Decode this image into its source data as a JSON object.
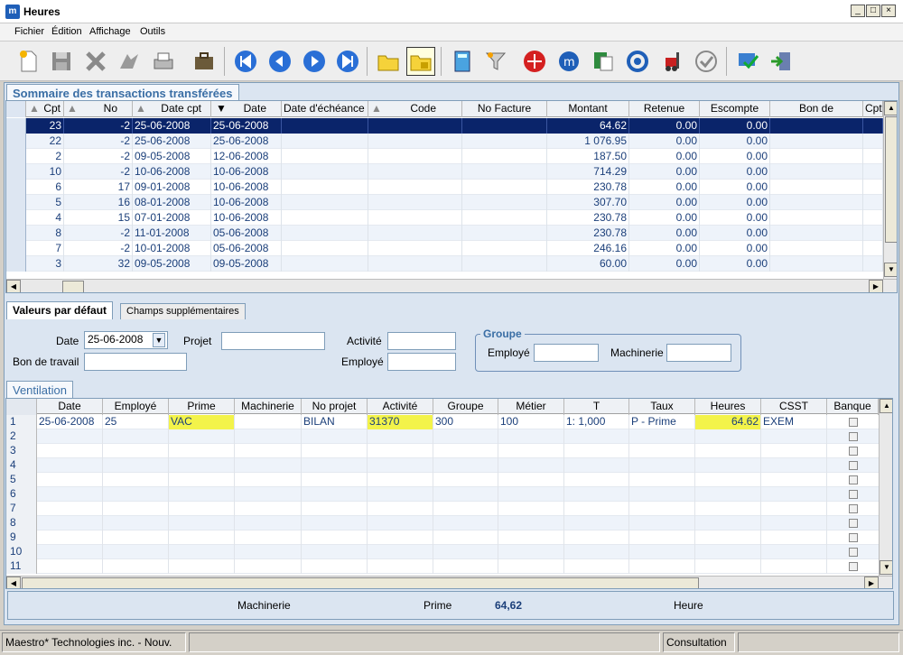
{
  "window": {
    "title": "Heures",
    "app_icon_letter": "m"
  },
  "menu": [
    "Fichier",
    "Édition",
    "Affichage",
    "Outils"
  ],
  "toolbar": {
    "icons": [
      "new-document-icon",
      "save-icon",
      "delete-icon",
      "transfer-icon",
      "print-icon",
      "briefcase-icon",
      "first-record-icon",
      "previous-record-icon",
      "next-record-icon",
      "last-record-icon",
      "folder-icon",
      "locked-folder-icon",
      "calculator-icon",
      "filter-icon",
      "target-icon",
      "maestro-link-icon",
      "excel-export-icon",
      "sync-icon",
      "forklift-icon",
      "approve-icon",
      "validate-icon",
      "exit-icon"
    ]
  },
  "summary": {
    "tab": "Sommaire des transactions transférées",
    "columns": [
      "Cpt",
      "No",
      "Date cpt",
      "Date",
      "Date d'échéance",
      "Code",
      "No Facture",
      "Montant",
      "Retenue",
      "Escompte",
      "Bon de",
      "Cpte"
    ],
    "rows": [
      [
        "23",
        "-2",
        "25-06-2008",
        "25-06-2008",
        "",
        "",
        "",
        "64.62",
        "0.00",
        "0.00",
        "",
        ""
      ],
      [
        "22",
        "-2",
        "25-06-2008",
        "25-06-2008",
        "",
        "",
        "",
        "1 076.95",
        "0.00",
        "0.00",
        "",
        ""
      ],
      [
        "2",
        "-2",
        "09-05-2008",
        "12-06-2008",
        "",
        "",
        "",
        "187.50",
        "0.00",
        "0.00",
        "",
        ""
      ],
      [
        "10",
        "-2",
        "10-06-2008",
        "10-06-2008",
        "",
        "",
        "",
        "714.29",
        "0.00",
        "0.00",
        "",
        ""
      ],
      [
        "6",
        "17",
        "09-01-2008",
        "10-06-2008",
        "",
        "",
        "",
        "230.78",
        "0.00",
        "0.00",
        "",
        ""
      ],
      [
        "5",
        "16",
        "08-01-2008",
        "10-06-2008",
        "",
        "",
        "",
        "307.70",
        "0.00",
        "0.00",
        "",
        ""
      ],
      [
        "4",
        "15",
        "07-01-2008",
        "10-06-2008",
        "",
        "",
        "",
        "230.78",
        "0.00",
        "0.00",
        "",
        ""
      ],
      [
        "8",
        "-2",
        "11-01-2008",
        "05-06-2008",
        "",
        "",
        "",
        "230.78",
        "0.00",
        "0.00",
        "",
        ""
      ],
      [
        "7",
        "-2",
        "10-01-2008",
        "05-06-2008",
        "",
        "",
        "",
        "246.16",
        "0.00",
        "0.00",
        "",
        ""
      ],
      [
        "3",
        "32",
        "09-05-2008",
        "09-05-2008",
        "",
        "",
        "",
        "60.00",
        "0.00",
        "0.00",
        "",
        ""
      ]
    ]
  },
  "defaults": {
    "tab_active": "Valeurs par défaut",
    "tab_other": "Champs supplémentaires",
    "date_label": "Date",
    "date_value": "25-06-2008",
    "projet_label": "Projet",
    "activite_label": "Activité",
    "bon_label": "Bon de travail",
    "employe_label": "Employé",
    "groupe_title": "Groupe",
    "groupe_employe_label": "Employé",
    "groupe_machinerie_label": "Machinerie"
  },
  "ventilation": {
    "tab": "Ventilation",
    "columns": [
      "Date",
      "Employé",
      "Prime",
      "Machinerie",
      "No projet",
      "Activité",
      "Groupe",
      "Métier",
      "T",
      "Taux",
      "Heures",
      "CSST",
      "Banque"
    ],
    "row_numbers": [
      "1",
      "2",
      "3",
      "4",
      "5",
      "6",
      "7",
      "8",
      "9",
      "10",
      "11"
    ],
    "rows": [
      [
        "25-06-2008",
        "25",
        "VAC",
        "",
        "BILAN",
        "31370",
        "300",
        "100",
        "1: 1,000",
        "P -  Prime",
        "64.62",
        "EXEM",
        ""
      ]
    ]
  },
  "totals": {
    "machinerie_label": "Machinerie",
    "prime_label": "Prime",
    "prime_value": "64,62",
    "heure_label": "Heure"
  },
  "status": {
    "company": "Maestro* Technologies inc. - Nouv.",
    "mode": "Consultation"
  },
  "colors": {
    "selection": "#0a246a",
    "highlight": "#f3f34a",
    "panel": "#dbe5f1",
    "accent": "#3a6ea5"
  }
}
